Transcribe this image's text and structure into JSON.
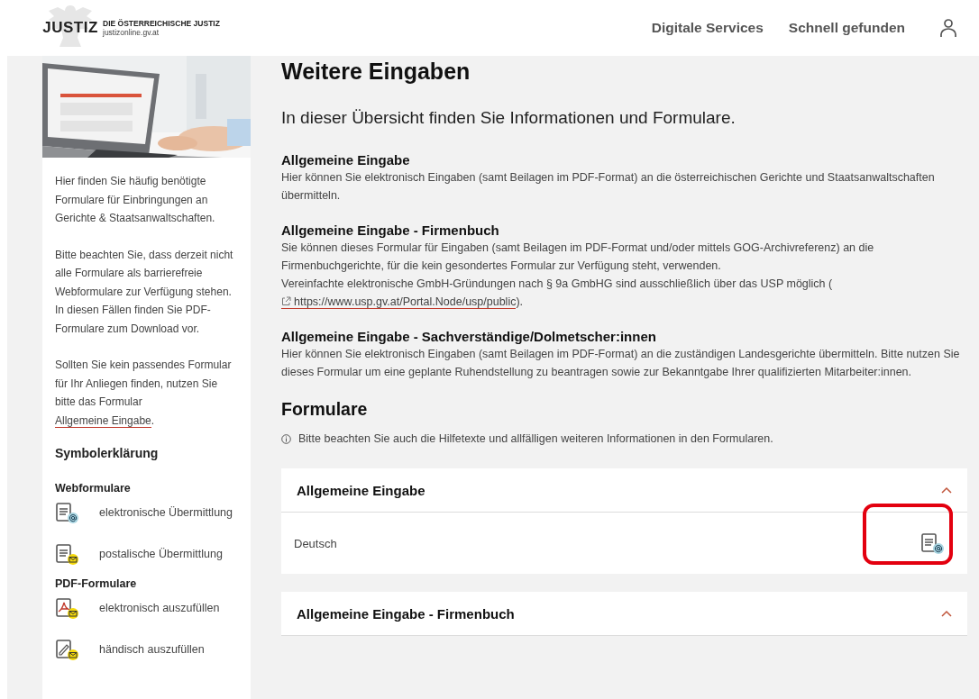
{
  "header": {
    "logo_text": "JUSTIZ",
    "org_name": "DIE ÖSTERREICHISCHE JUSTIZ",
    "org_url": "justizonline.gv.at",
    "nav": [
      "Digitale Services",
      "Schnell gefunden"
    ]
  },
  "sidebar": {
    "paragraphs": [
      {
        "text": "Hier finden Sie häufig benötigte Formulare für Einbringungen an Gerichte & Staatsanwaltschaften."
      },
      {
        "text": "Bitte beachten Sie, dass derzeit nicht alle Formulare als barrierefreie Webformulare zur Verfügung stehen. In diesen Fällen finden Sie PDF-Formulare zum Download vor."
      },
      {
        "text": "Sollten Sie kein passendes Formular für Ihr Anliegen finden, nutzen Sie bitte das Formular",
        "link": "Allgemeine Eingabe",
        "after": "."
      }
    ],
    "legend_title": "Symbolerklärung",
    "legend_groups": [
      {
        "title": "Webformulare",
        "items": [
          {
            "kind": "web-email",
            "label": "elektronische Übermittlung"
          },
          {
            "kind": "web-post",
            "label": "postalische Übermittlung"
          }
        ]
      },
      {
        "title": "PDF-Formulare",
        "items": [
          {
            "kind": "pdf-post",
            "label": "elektronisch auszufüllen"
          },
          {
            "kind": "hand-post",
            "label": "händisch auszufüllen"
          }
        ]
      }
    ]
  },
  "main": {
    "title": "Weitere Eingaben",
    "intro": "In dieser Übersicht finden Sie Informationen und Formulare.",
    "sections": [
      {
        "heading": "Allgemeine Eingabe",
        "lines": [
          {
            "text": "Hier können Sie elektronisch Eingaben (samt Beilagen im PDF-Format) an die österreichischen Gerichte und Staatsanwaltschaften übermitteln."
          }
        ]
      },
      {
        "heading": "Allgemeine Eingabe - Firmenbuch",
        "lines": [
          {
            "text": "Sie können dieses Formular für Eingaben (samt Beilagen im PDF-Format und/oder mittels GOG-Archivreferenz) an die Firmenbuchgerichte, für die kein gesondertes Formular zur Verfügung steht, verwenden."
          },
          {
            "text": "Vereinfachte elektronische GmbH-Gründungen nach § 9a GmbHG sind ausschließlich über das USP möglich (",
            "link": "https://www.usp.gv.at/Portal.Node/usp/public",
            "after": ")."
          }
        ]
      },
      {
        "heading": "Allgemeine Eingabe - Sachverständige/Dolmetscher:innen",
        "lines": [
          {
            "text": "Hier können Sie elektronisch Eingaben (samt Beilagen im PDF-Format) an die zuständigen Landesgerichte übermitteln. Bitte nutzen Sie dieses Formular um eine geplante Ruhendstellung zu beantragen sowie zur Bekanntgabe Ihrer qualifizierten Mitarbeiter:innen."
          }
        ]
      }
    ],
    "forms_title": "Formulare",
    "forms_note": "Bitte beachten Sie auch die Hilfetexte und allfälligen weiteren Informationen in den Formularen.",
    "accordions": [
      {
        "title": "Allgemeine Eingabe",
        "expanded": true,
        "rows": [
          {
            "label": "Deutsch",
            "kind": "web-email",
            "highlighted": true
          }
        ]
      },
      {
        "title": "Allgemeine Eingabe - Firmenbuch",
        "expanded": true
      }
    ]
  }
}
